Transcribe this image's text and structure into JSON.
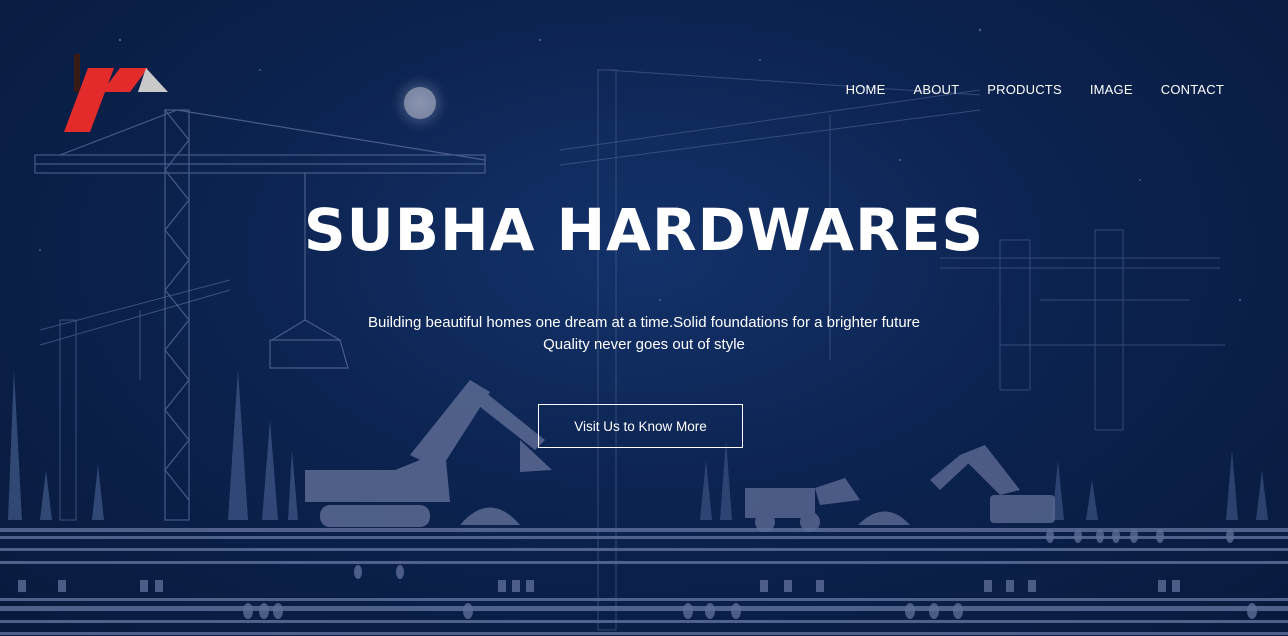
{
  "brand": {
    "logo_icon": "house-roof-logo",
    "colors": {
      "red": "#e32b2b",
      "gray": "#c9c9c9",
      "dark": "#3a1a14"
    }
  },
  "nav": {
    "items": [
      {
        "label": "HOME"
      },
      {
        "label": "ABOUT"
      },
      {
        "label": "PRODUCTS"
      },
      {
        "label": "IMAGE"
      },
      {
        "label": "CONTACT"
      }
    ]
  },
  "hero": {
    "title": "SUBHA HARDWARES",
    "tagline_line1": "Building beautiful homes one dream at a time.Solid foundations for a brighter future",
    "tagline_line2": "Quality never goes out of style",
    "cta_label": "Visit Us to Know More",
    "background_colors": {
      "top": "#13326a",
      "bottom": "#081a3d"
    },
    "illustration": "construction-site-cranes-silhouette"
  }
}
